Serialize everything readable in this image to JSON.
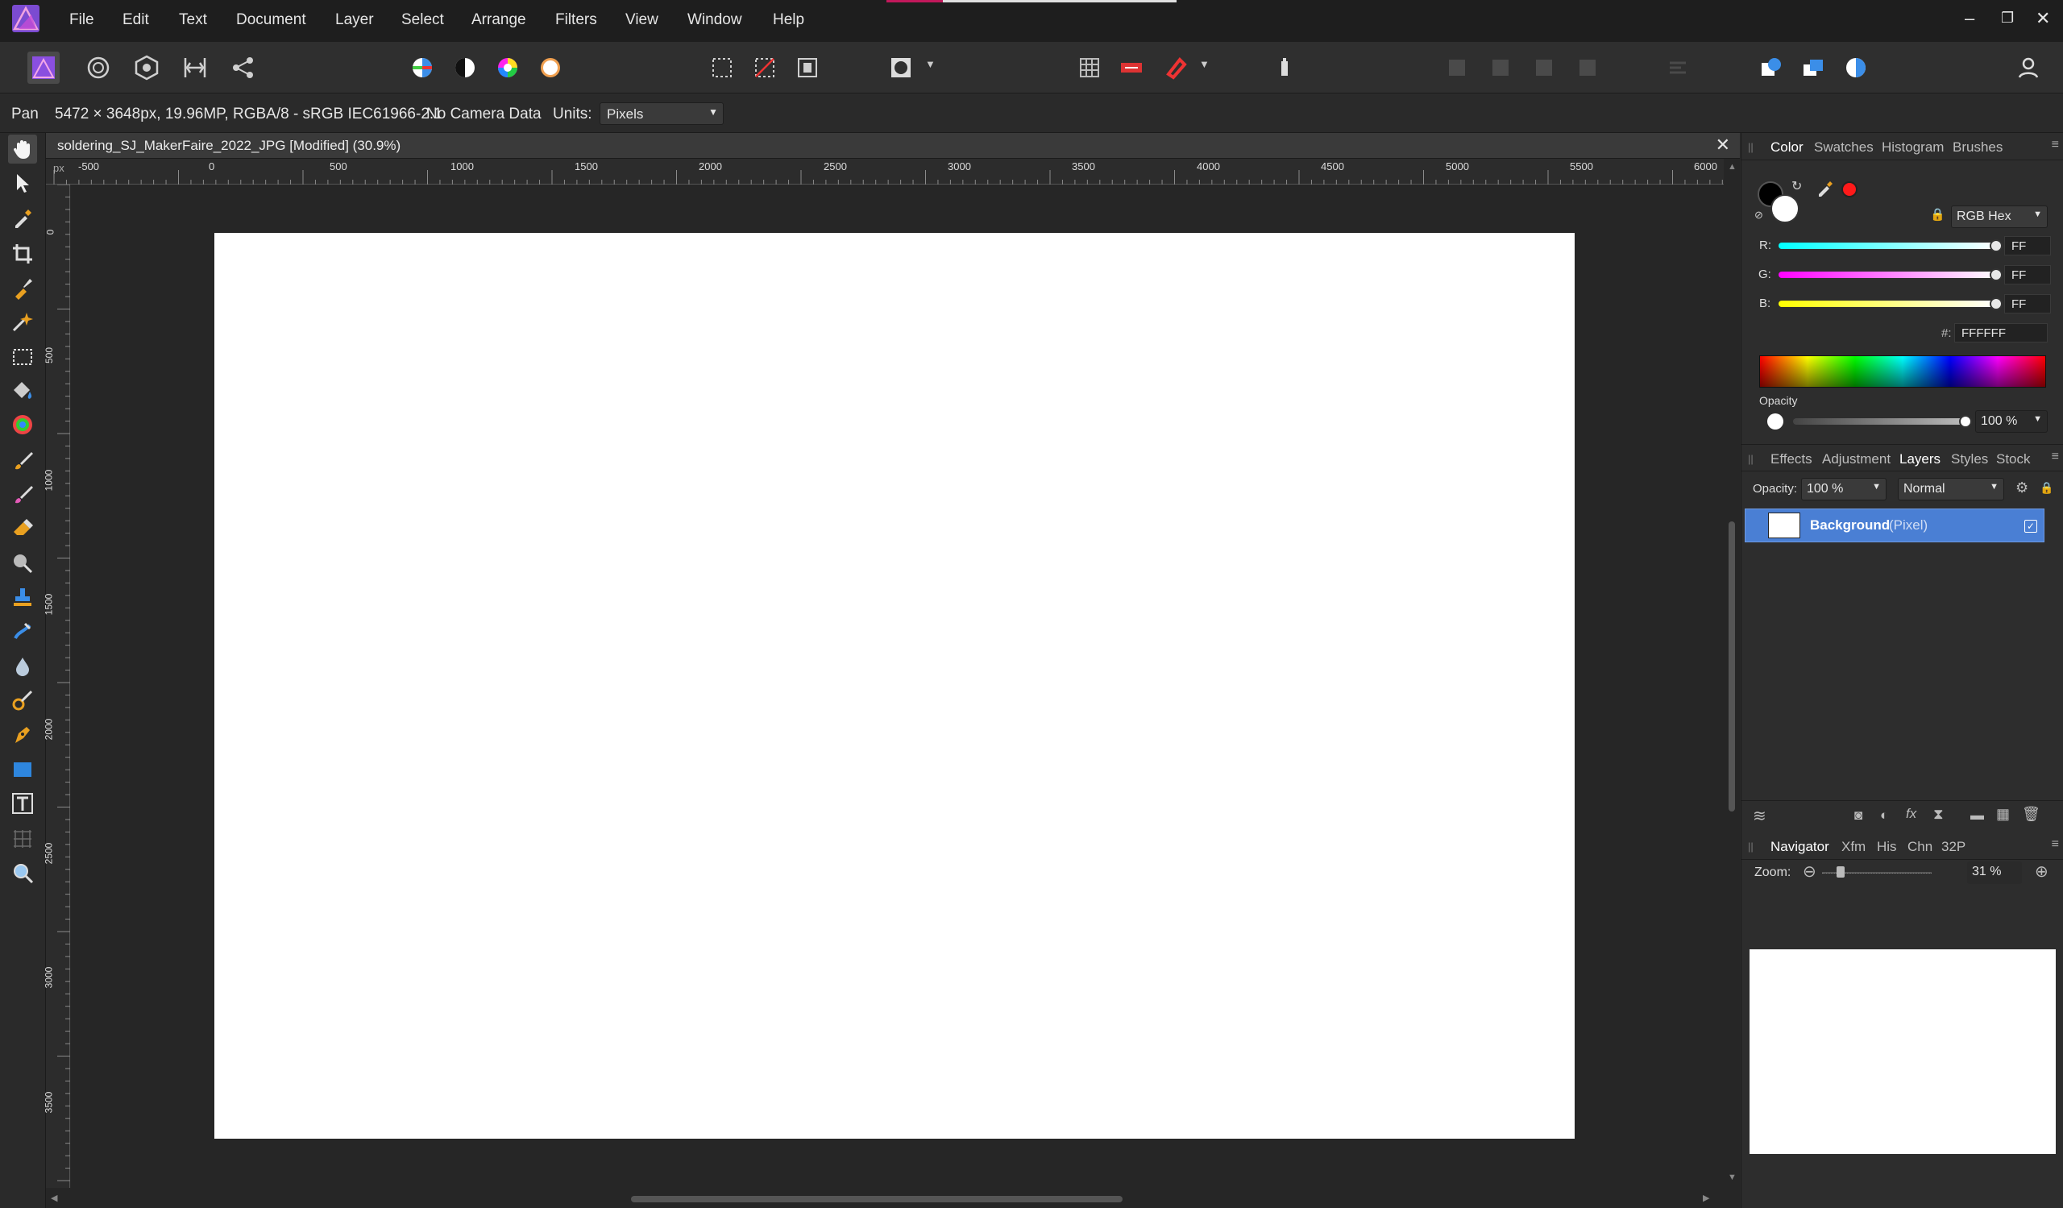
{
  "menubar": {
    "items": [
      "File",
      "Edit",
      "Text",
      "Document",
      "Layer",
      "Select",
      "Arrange",
      "Filters",
      "View",
      "Window",
      "Help"
    ],
    "window_controls": {
      "minimize": "–",
      "restore": "❐",
      "close": "✕"
    }
  },
  "context": {
    "tool_name": "Pan",
    "doc_info": "5472 × 3648px, 19.96MP, RGBA/8 - sRGB IEC61966-2.1",
    "camera": "No Camera Data",
    "units_label": "Units:",
    "units_value": "Pixels"
  },
  "document": {
    "title": "soldering_SJ_MakerFaire_2022_JPG [Modified] (30.9%)",
    "close": "✕",
    "ruler_unit": "px",
    "ruler_top": [
      "-500",
      "0",
      "500",
      "1000",
      "1500",
      "2000",
      "2500",
      "3000",
      "3500",
      "4000",
      "4500",
      "5000",
      "5500",
      "6000"
    ],
    "ruler_left": [
      "0",
      "500",
      "1000",
      "1500",
      "2000",
      "2500",
      "3000",
      "3500"
    ]
  },
  "color_panel": {
    "tabs": [
      "Color",
      "Swatches",
      "Histogram",
      "Brushes"
    ],
    "active_tab": "Color",
    "model": "RGB Hex",
    "r_label": "R:",
    "r_value": "FF",
    "g_label": "G:",
    "g_value": "FF",
    "b_label": "B:",
    "b_value": "FF",
    "hex_label": "#:",
    "hex_value": "FFFFFF",
    "opacity_label": "Opacity",
    "opacity_value": "100 %",
    "accent_red": "#ff1a1a"
  },
  "layers_panel": {
    "tabs": [
      "Effects",
      "Adjustment",
      "Layers",
      "Styles",
      "Stock"
    ],
    "active_tab": "Layers",
    "opacity_label": "Opacity:",
    "opacity_value": "100 %",
    "blend_mode": "Normal",
    "layers": [
      {
        "name": "Background",
        "type": "(Pixel)",
        "visible": true
      }
    ],
    "selected_color": "#4a7fd4"
  },
  "navigator_panel": {
    "tabs": [
      "Navigator",
      "Xfm",
      "His",
      "Chn",
      "32P"
    ],
    "active_tab": "Navigator",
    "zoom_label": "Zoom:",
    "zoom_value": "31 %"
  }
}
